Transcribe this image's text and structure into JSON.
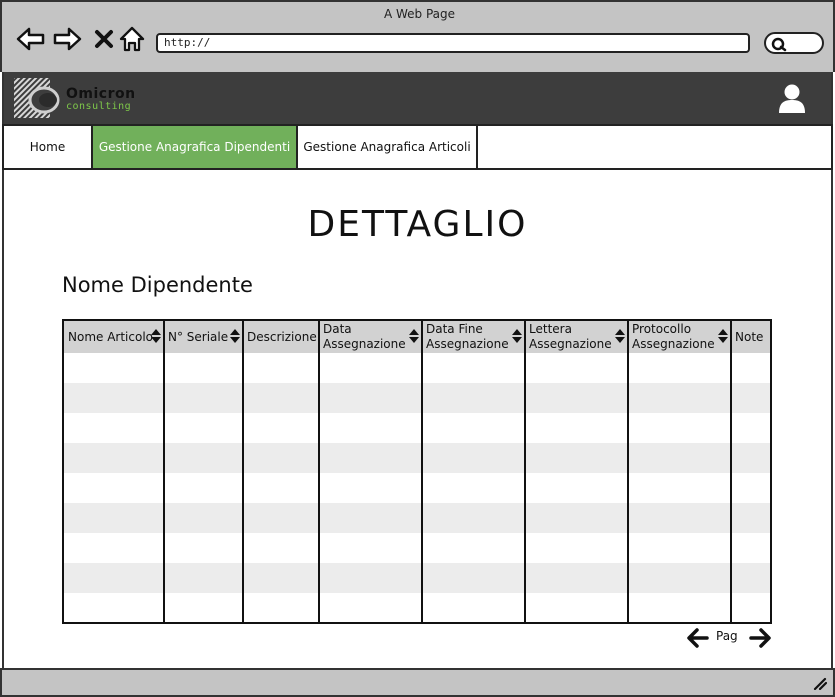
{
  "window": {
    "title": "A Web Page"
  },
  "browser": {
    "url": "http://",
    "search_placeholder": ""
  },
  "header": {
    "logo": {
      "name": "Omicron",
      "tagline": "consulting"
    },
    "user_icon": "user-icon"
  },
  "tabs": [
    {
      "label": "Home",
      "active": false
    },
    {
      "label": "Gestione Anagrafica Dipendenti",
      "active": true
    },
    {
      "label": "Gestione Anagrafica Articoli",
      "active": false
    }
  ],
  "page": {
    "title": "DETTAGLIO",
    "section_title": "Nome Dipendente"
  },
  "table": {
    "columns": [
      {
        "label": "Nome Articolo",
        "sortable": true
      },
      {
        "label": "N° Seriale",
        "sortable": true
      },
      {
        "label": "Descrizione",
        "sortable": false
      },
      {
        "label": "Data Assegnazione",
        "sortable": true
      },
      {
        "label": "Data Fine Assegnazione",
        "sortable": true
      },
      {
        "label": "Lettera Assegnazione",
        "sortable": true
      },
      {
        "label": "Protocollo Assegnazione",
        "sortable": true
      },
      {
        "label": "Note",
        "sortable": false
      }
    ],
    "rows": []
  },
  "pager": {
    "label": "Pag"
  },
  "colors": {
    "accent": "#71b05b",
    "header_bg": "#3d3d3d",
    "chrome_bg": "#c4c4c4",
    "table_header_bg": "#d2d2d2",
    "row_alt_bg": "#ececec"
  }
}
